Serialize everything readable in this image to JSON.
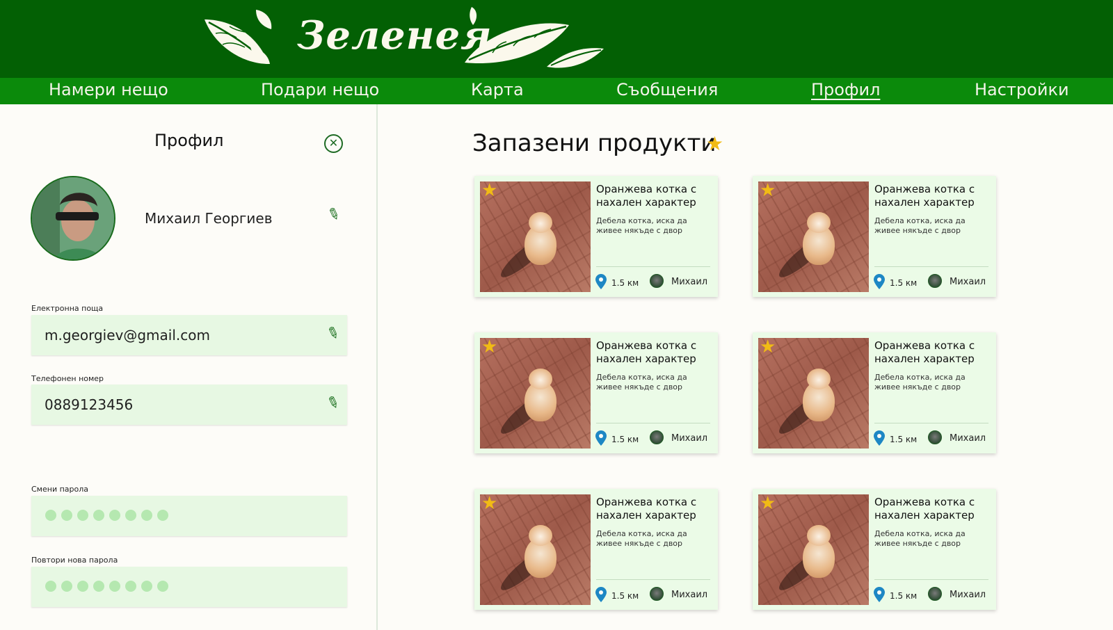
{
  "app": {
    "logo_text": "Зеленея",
    "header_color": "#036004",
    "nav_color": "#0b8a0b",
    "accent_star": "#f1bb15"
  },
  "nav": {
    "items": [
      {
        "label": "Намери нещо",
        "active": false
      },
      {
        "label": "Подари нещо",
        "active": false
      },
      {
        "label": "Карта",
        "active": false
      },
      {
        "label": "Съобщения",
        "active": false
      },
      {
        "label": "Профил",
        "active": true
      },
      {
        "label": "Настройки",
        "active": false
      }
    ]
  },
  "profile": {
    "title": "Профил",
    "close_icon": "close-circle-icon",
    "name": "Михаил Георгиев",
    "fields": [
      {
        "label": "Електронна поща",
        "value": "m.georgiev@gmail.com"
      },
      {
        "label": "Телефонен номер",
        "value": "0889123456"
      },
      {
        "label": "Смени парола",
        "masked_length": 8
      },
      {
        "label": "Повтори нова парола",
        "masked_length": 8
      }
    ]
  },
  "saved": {
    "title": "Запазени продукти",
    "cards": [
      {
        "title": "Оранжева котка с нахален характер",
        "description": "Дебела котка, иска да живее някъде с двор",
        "distance": "1.5 км",
        "owner": "Михаил"
      },
      {
        "title": "Оранжева котка с нахален характер",
        "description": "Дебела котка, иска да живее някъде с двор",
        "distance": "1.5 км",
        "owner": "Михаил"
      },
      {
        "title": "Оранжева котка с нахален характер",
        "description": "Дебела котка, иска да живее някъде с двор",
        "distance": "1.5 км",
        "owner": "Михаил"
      },
      {
        "title": "Оранжева котка с нахален характер",
        "description": "Дебела котка, иска да живее някъде с двор",
        "distance": "1.5 км",
        "owner": "Михаил"
      },
      {
        "title": "Оранжева котка с нахален характер",
        "description": "Дебела котка, иска да живее някъде с двор",
        "distance": "1.5 км",
        "owner": "Михаил"
      },
      {
        "title": "Оранжева котка с нахален характер",
        "description": "Дебела котка, иска да живее някъде с двор",
        "distance": "1.5 км",
        "owner": "Михаил"
      }
    ]
  }
}
